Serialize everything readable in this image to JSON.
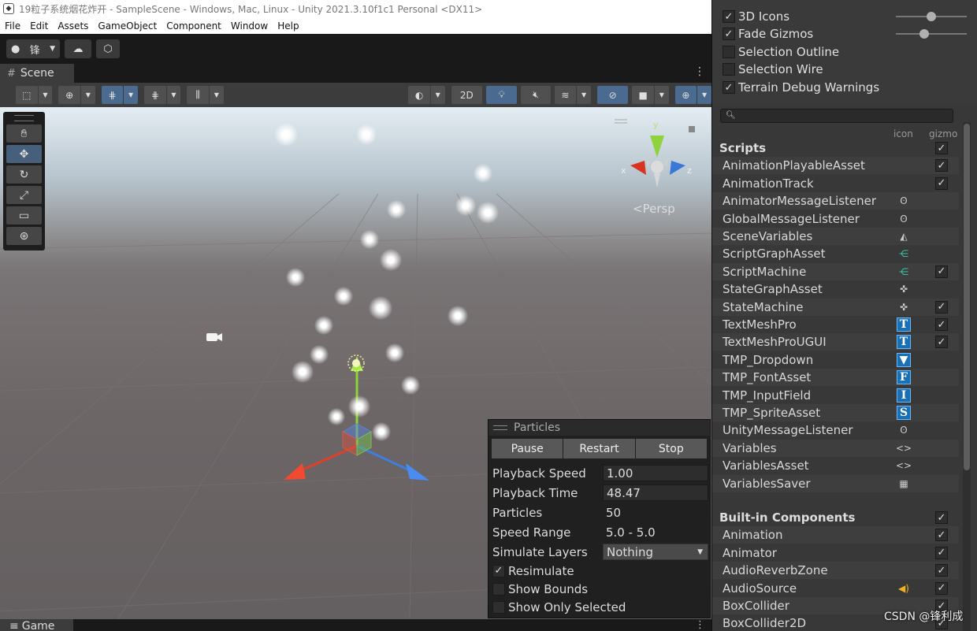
{
  "window": {
    "title": "19粒子系统烟花炸开 - SampleScene - Windows, Mac, Linux - Unity 2021.3.10f1c1 Personal <DX11>"
  },
  "menu": [
    "File",
    "Edit",
    "Assets",
    "GameObject",
    "Component",
    "Window",
    "Help"
  ],
  "toolbar": {
    "account": "锋"
  },
  "scene": {
    "tab": "Scene",
    "btn_2d": "2D",
    "persp_label": "Persp",
    "gizmo_axes": {
      "y": "y",
      "x": "x",
      "z": "z"
    }
  },
  "game": {
    "tab": "Game"
  },
  "particles": {
    "title": "Particles",
    "buttons": [
      "Pause",
      "Restart",
      "Stop"
    ],
    "rows": [
      {
        "label": "Playback Speed",
        "value": "1.00"
      },
      {
        "label": "Playback Time",
        "value": "48.47"
      },
      {
        "label": "Particles",
        "value": "50"
      },
      {
        "label": "Speed Range",
        "value": "5.0 - 5.0"
      },
      {
        "label": "Simulate Layers",
        "value": "Nothing"
      }
    ],
    "checks": [
      {
        "label": "Resimulate",
        "checked": true
      },
      {
        "label": "Show Bounds",
        "checked": false
      },
      {
        "label": "Show Only Selected",
        "checked": false
      }
    ]
  },
  "gizmos": {
    "toggles": [
      {
        "label": "3D Icons",
        "checked": true
      },
      {
        "label": "Fade Gizmos",
        "checked": true
      },
      {
        "label": "Selection Outline",
        "checked": false
      },
      {
        "label": "Selection Wire",
        "checked": false
      },
      {
        "label": "Terrain Debug Warnings",
        "checked": true
      }
    ],
    "slider_3d_icons": 0.5,
    "slider_fade": 0.4,
    "col_icon": "icon",
    "col_gizmo": "gizmo",
    "scripts_header": "Scripts",
    "scripts": [
      {
        "name": "AnimationPlayableAsset",
        "icon": "",
        "gizmo": true
      },
      {
        "name": "AnimationTrack",
        "icon": "",
        "gizmo": true
      },
      {
        "name": "AnimatorMessageListener",
        "icon": "ear-icon",
        "gizmo": false
      },
      {
        "name": "GlobalMessageListener",
        "icon": "ear-icon",
        "gizmo": false
      },
      {
        "name": "SceneVariables",
        "icon": "scene-var-icon",
        "gizmo": false
      },
      {
        "name": "ScriptGraphAsset",
        "icon": "graph-icon",
        "gizmo": false
      },
      {
        "name": "ScriptMachine",
        "icon": "graph-icon",
        "gizmo": true
      },
      {
        "name": "StateGraphAsset",
        "icon": "state-icon",
        "gizmo": false
      },
      {
        "name": "StateMachine",
        "icon": "state-icon",
        "gizmo": true
      },
      {
        "name": "TextMeshPro",
        "icon": "T",
        "gizmo": true
      },
      {
        "name": "TextMeshProUGUI",
        "icon": "T",
        "gizmo": true
      },
      {
        "name": "TMP_Dropdown",
        "icon": "▼",
        "gizmo": false
      },
      {
        "name": "TMP_FontAsset",
        "icon": "F",
        "gizmo": false
      },
      {
        "name": "TMP_InputField",
        "icon": "I",
        "gizmo": false
      },
      {
        "name": "TMP_SpriteAsset",
        "icon": "S",
        "gizmo": false
      },
      {
        "name": "UnityMessageListener",
        "icon": "ear-icon",
        "gizmo": false
      },
      {
        "name": "Variables",
        "icon": "code-icon",
        "gizmo": false
      },
      {
        "name": "VariablesAsset",
        "icon": "code-icon",
        "gizmo": false
      },
      {
        "name": "VariablesSaver",
        "icon": "saver-icon",
        "gizmo": false
      }
    ],
    "builtin_header": "Built-in Components",
    "builtin": [
      {
        "name": "Animation",
        "icon": "",
        "gizmo": true
      },
      {
        "name": "Animator",
        "icon": "",
        "gizmo": true
      },
      {
        "name": "AudioReverbZone",
        "icon": "",
        "gizmo": true
      },
      {
        "name": "AudioSource",
        "icon": "speaker-icon",
        "gizmo": true
      },
      {
        "name": "BoxCollider",
        "icon": "",
        "gizmo": true
      },
      {
        "name": "BoxCollider2D",
        "icon": "",
        "gizmo": true
      }
    ]
  },
  "watermark": "CSDN @锋利成"
}
